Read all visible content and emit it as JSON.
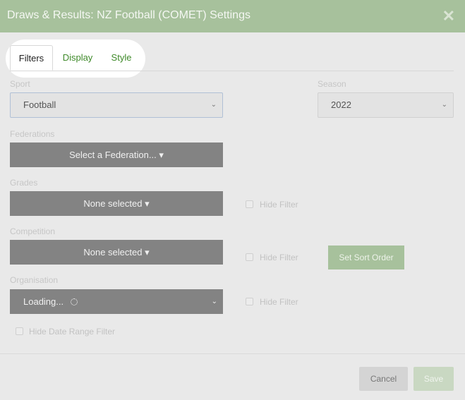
{
  "dialog": {
    "title": "Draws & Results: NZ Football (COMET) Settings",
    "close_icon": "close-icon"
  },
  "tabs": [
    {
      "label": "Filters",
      "active": true
    },
    {
      "label": "Display",
      "active": false
    },
    {
      "label": "Style",
      "active": false
    }
  ],
  "sport": {
    "label": "Sport",
    "value": "Football"
  },
  "season": {
    "label": "Season",
    "value": "2022"
  },
  "federations": {
    "label": "Federations",
    "value": "Select a Federation..."
  },
  "grades": {
    "label": "Grades",
    "value": "None selected",
    "hide_filter_label": "Hide Filter"
  },
  "competition": {
    "label": "Competition",
    "value": "None selected",
    "hide_filter_label": "Hide Filter",
    "sort_button": "Set Sort Order"
  },
  "organisation": {
    "label": "Organisation",
    "value": "Loading...",
    "hide_filter_label": "Hide Filter"
  },
  "hide_date_range": {
    "label": "Hide Date Range Filter"
  },
  "footer": {
    "cancel_label": "Cancel",
    "save_label": "Save"
  },
  "colors": {
    "header": "#a7c19c",
    "accent_link": "#3f8a2a",
    "dropdown": "#838383"
  }
}
